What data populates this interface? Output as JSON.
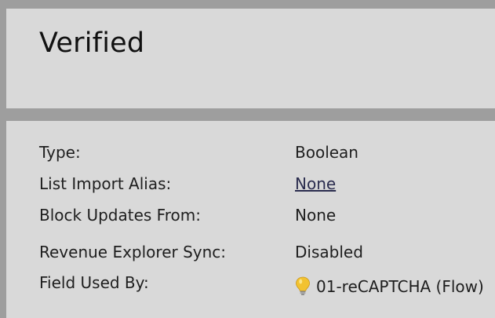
{
  "header": {
    "title": "Verified"
  },
  "details": {
    "rows": [
      {
        "label": "Type:",
        "value": "Boolean"
      },
      {
        "label": "List Import Alias:",
        "value": "None",
        "link": true
      },
      {
        "label": "Block Updates From:",
        "value": "None"
      },
      {
        "label": "Revenue Explorer Sync:",
        "value": "Disabled"
      },
      {
        "label": "Field Used By:",
        "value": "01-reCAPTCHA (Flow)",
        "icon": "lightbulb-icon"
      }
    ]
  },
  "colors": {
    "background": "#9e9e9e",
    "panel": "#d9d9d9",
    "text": "#1e1e1e",
    "link": "#2b2d4f",
    "bulb": "#f2c230"
  }
}
